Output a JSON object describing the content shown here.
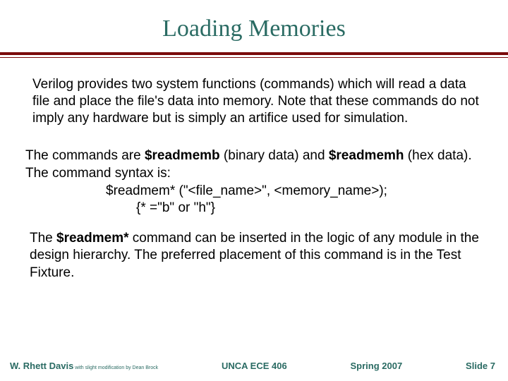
{
  "title": "Loading Memories",
  "para1": "Verilog provides two system functions (commands) which will read a data file and place the file's data into memory. Note that these commands do not imply any hardware but is simply an artifice used for simulation.",
  "para2_pre": "The commands are ",
  "cmd_b": "$readmemb",
  "para2_mid1": " (binary data) and ",
  "cmd_h": "$readmemh",
  "para2_post": " (hex data).  The command syntax is:",
  "syntax1": "$readmem* (\"<file_name>\", <memory_name>);",
  "syntax2": "{* =\"b\" or \"h\"}",
  "para3_pre": "The ",
  "cmd_star": "$readmem*",
  "para3_post": " command can be inserted in the logic of any module in the design hierarchy.  The preferred placement of this command is in the Test Fixture.",
  "footer": {
    "author": "W. Rhett Davis",
    "mod": " with slight modification by Dean Brock",
    "course": "UNCA ECE 406",
    "term": "Spring 2007",
    "slide": "Slide 7"
  }
}
